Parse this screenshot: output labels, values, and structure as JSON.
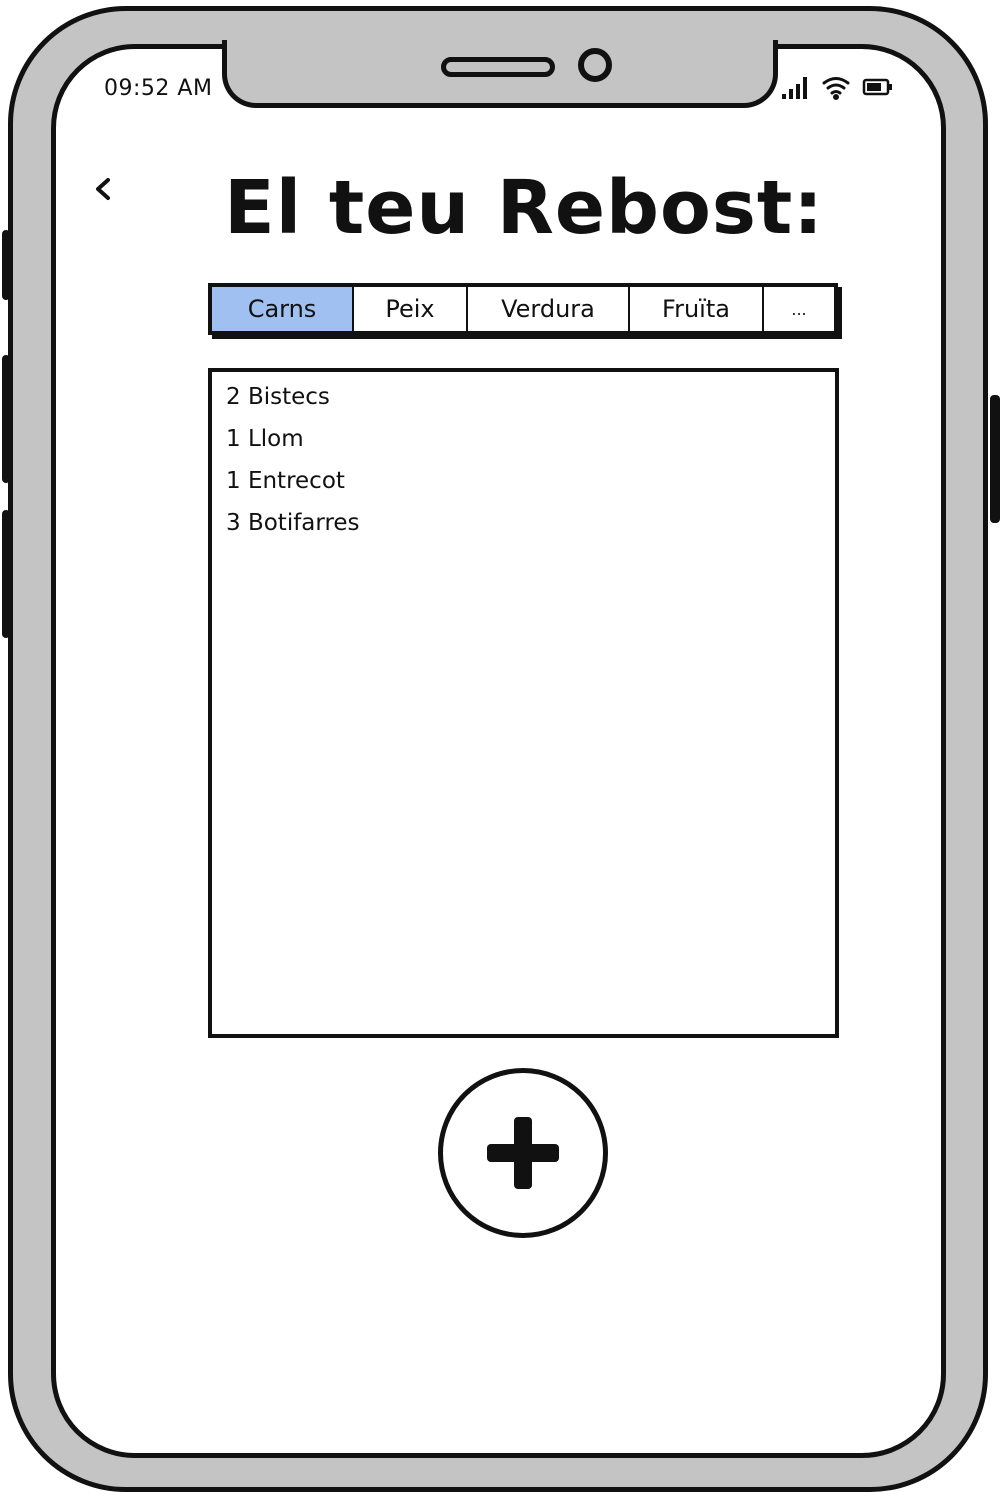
{
  "status_bar": {
    "time": "09:52 AM",
    "icons": [
      "signal-icon",
      "wifi-icon",
      "battery-icon"
    ]
  },
  "header": {
    "back_icon": "chevron-left-icon",
    "title": "El teu Rebost:"
  },
  "tabs": [
    {
      "label": "Carns",
      "active": true
    },
    {
      "label": "Peix",
      "active": false
    },
    {
      "label": "Verdura",
      "active": false
    },
    {
      "label": "Fruïta",
      "active": false
    },
    {
      "label": "...",
      "active": false
    }
  ],
  "items": [
    "2 Bistecs",
    "1 Llom",
    "1 Entrecot",
    "3 Botifarres"
  ],
  "actions": {
    "add_icon": "plus-icon"
  },
  "colors": {
    "active_tab": "#a0c0f2",
    "frame": "#c4c4c4",
    "stroke": "#111111"
  }
}
